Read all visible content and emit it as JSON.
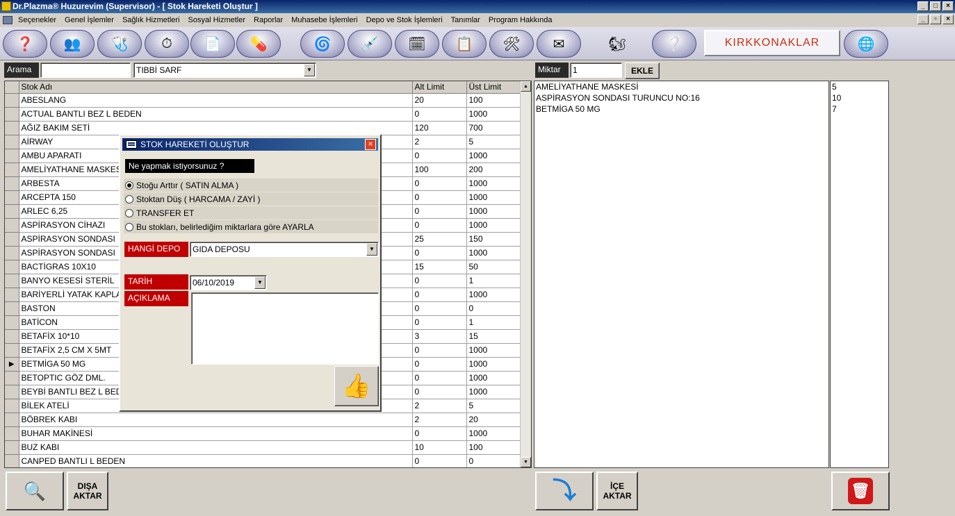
{
  "window": {
    "title": "Dr.Plazma® Huzurevim (Supervisor) - [ Stok Hareketi Oluştur ]"
  },
  "menu": [
    "Seçenekler",
    "Genel İşlemler",
    "Sağlık Hizmetleri",
    "Sosyal Hizmetler",
    "Raporlar",
    "Muhasebe İşlemleri",
    "Depo ve Stok İşlemleri",
    "Tanımlar",
    "Program Hakkında"
  ],
  "brand": "KIRKKONAKLAR",
  "search": {
    "label": "Arama",
    "value": "",
    "category": "TIBBİ SARF"
  },
  "miktar": {
    "label": "Miktar",
    "value": "1",
    "add_button": "EKLE"
  },
  "grid": {
    "headers": [
      "Stok Adı",
      "Alt Limit",
      "Üst Limit"
    ],
    "rows": [
      [
        "ABESLANG",
        "20",
        "100"
      ],
      [
        "ACTUAL BANTLI BEZ L BEDEN",
        "0",
        "1000"
      ],
      [
        "AĞIZ BAKIM SETİ",
        "120",
        "700"
      ],
      [
        "AİRWAY",
        "2",
        "5"
      ],
      [
        "AMBU APARATI",
        "0",
        "1000"
      ],
      [
        "AMELİYATHANE MASKESİ",
        "100",
        "200"
      ],
      [
        "ARBESTA",
        "0",
        "1000"
      ],
      [
        "ARCEPTA 150",
        "0",
        "1000"
      ],
      [
        "ARLEC 6,25",
        "0",
        "1000"
      ],
      [
        "ASPİRASYON CİHAZI",
        "0",
        "1000"
      ],
      [
        "ASPİRASYON SONDASI",
        "25",
        "150"
      ],
      [
        "ASPİRASYON SONDASI",
        "0",
        "1000"
      ],
      [
        "BACTİGRAS 10X10",
        "15",
        "50"
      ],
      [
        "BANYO KESESİ STERİL",
        "0",
        "1"
      ],
      [
        "BARİYERLİ YATAK KAPLAMA",
        "0",
        "1000"
      ],
      [
        "BASTON",
        "0",
        "0"
      ],
      [
        "BATİCON",
        "0",
        "1"
      ],
      [
        "BETAFİX 10*10",
        "3",
        "15"
      ],
      [
        "BETAFİX 2,5 CM X 5MT",
        "0",
        "1000"
      ],
      [
        "BETMİGA 50 MG",
        "0",
        "1000"
      ],
      [
        "BETOPTIC GÖZ DML.",
        "0",
        "1000"
      ],
      [
        "BEYBİ BANTLI BEZ L BEDEN",
        "0",
        "1000"
      ],
      [
        "BİLEK ATELİ",
        "2",
        "5"
      ],
      [
        "BÖBREK KABI",
        "2",
        "20"
      ],
      [
        "BUHAR MAKİNESİ",
        "0",
        "1000"
      ],
      [
        "BUZ KABI",
        "10",
        "100"
      ],
      [
        "CANPED BANTLI L BEDEN",
        "0",
        "0"
      ]
    ],
    "selected_row": 19
  },
  "selected_items": {
    "names": [
      "AMELİYATHANE MASKESİ",
      "ASPİRASYON SONDASI TURUNCU NO:16",
      "BETMİGA 50 MG"
    ],
    "quantities": [
      "5",
      "10",
      "7"
    ]
  },
  "dialog": {
    "title": "STOK HAREKETİ OLUŞTUR",
    "question": "Ne yapmak istiyorsunuz ?",
    "options": [
      "Stoğu Arttır ( SATIN ALMA )",
      "Stoktan Düş ( HARCAMA / ZAYİ )",
      "TRANSFER ET",
      "Bu stokları, belirlediğim miktarlara göre AYARLA"
    ],
    "selected_option": 0,
    "depo_label": "HANGİ DEPO",
    "depo_value": "GIDA DEPOSU",
    "tarih_label": "TARİH",
    "tarih_value": "06/10/2019",
    "aciklama_label": "AÇIKLAMA",
    "aciklama_value": ""
  },
  "bottom": {
    "export_label_1": "DIŞA",
    "export_label_2": "AKTAR",
    "import_label_1": "İÇE",
    "import_label_2": "AKTAR"
  }
}
